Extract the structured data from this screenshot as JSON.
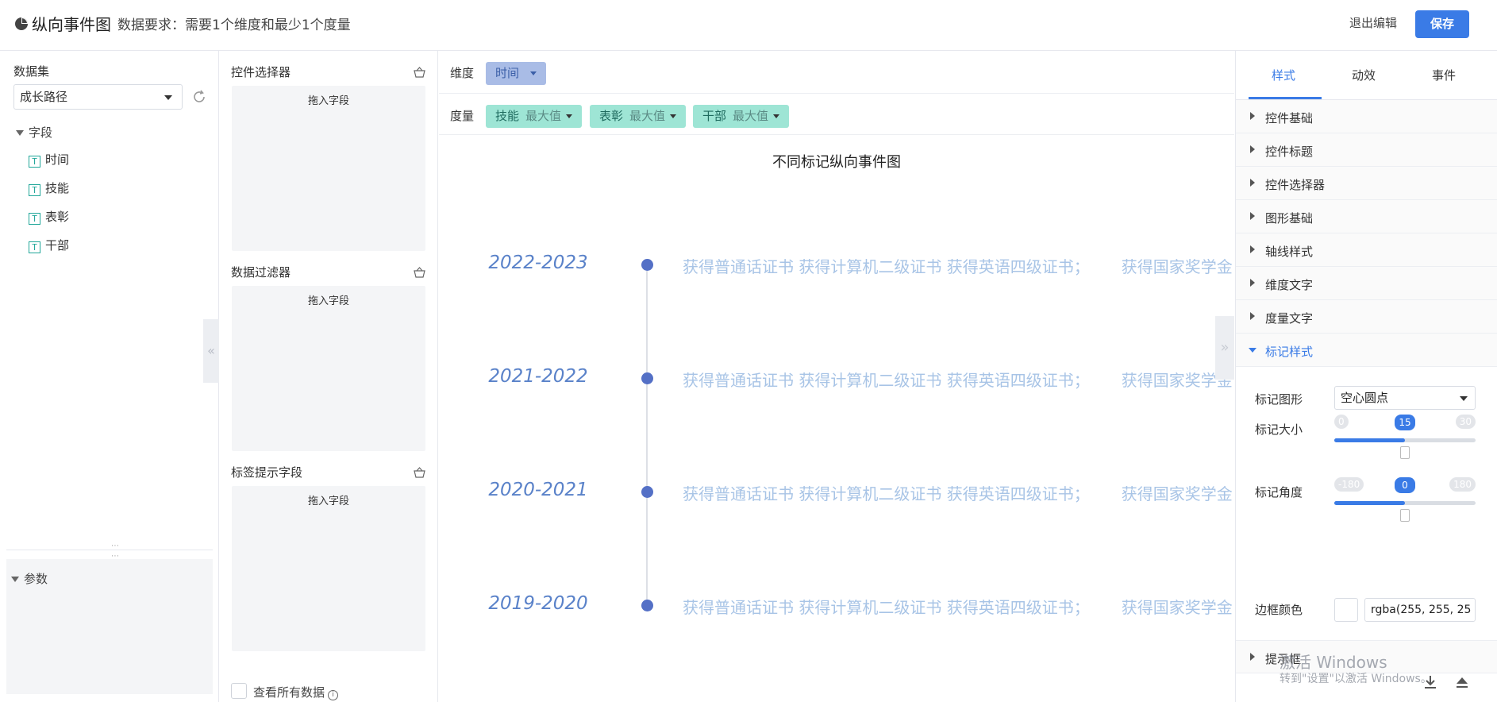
{
  "header": {
    "title": "纵向事件图",
    "requirement": "数据要求：需要1个维度和最少1个度量",
    "exit_label": "退出编辑",
    "save_label": "保存"
  },
  "dataset_panel": {
    "label": "数据集",
    "selected": "成长路径",
    "fields_label": "字段",
    "fields": [
      "时间",
      "技能",
      "表彰",
      "干部"
    ],
    "field_type_icon": "T",
    "params_label": "参数"
  },
  "config_panel": {
    "control_selector": {
      "label": "控件选择器",
      "drop_hint": "拖入字段"
    },
    "data_filter": {
      "label": "数据过滤器",
      "drop_hint": "拖入字段"
    },
    "tooltip_fields": {
      "label": "标签提示字段",
      "drop_hint": "拖入字段"
    },
    "view_all_label": "查看所有数据"
  },
  "fields_bar": {
    "dimension_label": "维度",
    "dimensions": [
      {
        "name": "时间"
      }
    ],
    "measure_label": "度量",
    "measures": [
      {
        "name": "技能",
        "agg": "最大值"
      },
      {
        "name": "表彰",
        "agg": "最大值"
      },
      {
        "name": "干部",
        "agg": "最大值"
      }
    ]
  },
  "chart": {
    "title": "不同标记纵向事件图",
    "events": [
      {
        "year": "2022-2023",
        "text": "获得普通话证书 获得计算机二级证书 获得英语四级证书；",
        "extra": "获得国家奖学金"
      },
      {
        "year": "2021-2022",
        "text": "获得普通话证书 获得计算机二级证书 获得英语四级证书；",
        "extra": "获得国家奖学金"
      },
      {
        "year": "2020-2021",
        "text": "获得普通话证书 获得计算机二级证书 获得英语四级证书；",
        "extra": "获得国家奖学金"
      },
      {
        "year": "2019-2020",
        "text": "获得普通话证书 获得计算机二级证书 获得英语四级证书；",
        "extra": "获得国家奖学金"
      }
    ],
    "marker_color": "#5470c6",
    "year_color": "#5a82c9",
    "event_color": "#a8c4e6"
  },
  "style_panel": {
    "tabs": [
      "样式",
      "动效",
      "事件"
    ],
    "active_tab": "样式",
    "sections": [
      "控件基础",
      "控件标题",
      "控件选择器",
      "图形基础",
      "轴线样式",
      "维度文字",
      "度量文字",
      "标记样式"
    ],
    "marker": {
      "shape_label": "标记图形",
      "shape_value": "空心圆点",
      "size_label": "标记大小",
      "size": {
        "min": "0",
        "max": "30",
        "value": "15",
        "fraction": 0.5
      },
      "angle_label": "标记角度",
      "angle": {
        "min": "-180",
        "max": "180",
        "value": "0",
        "fraction": 0.5
      },
      "border_color_label": "边框颜色",
      "border_color_value": "rgba(255, 255, 25"
    },
    "tooltip_section": "提示框",
    "watermark_title": "激活 Windows",
    "watermark_sub": "转到\"设置\"以激活 Windows。"
  },
  "colors": {
    "accent": "#3a7be6",
    "dimension_pill": "#a9bce6",
    "measure_pill": "#9ee5d5"
  }
}
